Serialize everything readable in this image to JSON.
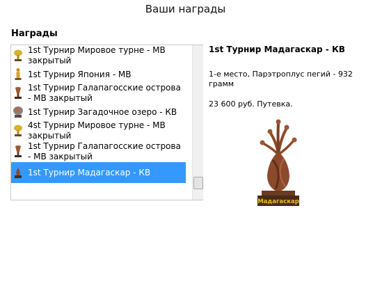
{
  "page": {
    "title": "Ваши награды"
  },
  "awards": {
    "heading": "Награды",
    "items": [
      {
        "label": "1st Турнир Мировое турне - МВ закрытый",
        "icon": "gold-trophy-icon"
      },
      {
        "label": "1st Турнир Япония - МВ",
        "icon": "gold-figurine-icon"
      },
      {
        "label": "1st Турнир Галапагосские острова - МВ закрытый",
        "icon": "bronze-trophy-icon"
      },
      {
        "label": "1st Турнир Загадочное озеро - КВ",
        "icon": "stone-trophy-icon"
      },
      {
        "label": "4st Турнир Мировое турне - МВ закрытый",
        "icon": "gold-trophy-icon"
      },
      {
        "label": "1st Турнир Галапагосские острова - МВ закрытый",
        "icon": "bronze-trophy-icon"
      },
      {
        "label": "1st Турнир Мадагаскар - КВ",
        "icon": "wood-trophy-icon",
        "selected": true
      }
    ]
  },
  "detail": {
    "title": "1st Турнир Мадагаскар - КВ",
    "place": "1-е место, Парэтроплус пегий - 932 грамм",
    "prize": "23 600 руб. Путевка.",
    "trophy_caption": "Мадагаскар"
  },
  "colors": {
    "selection": "#3399ff",
    "trophy_wood": "#8b4a2b",
    "caption": "#e8c020"
  }
}
